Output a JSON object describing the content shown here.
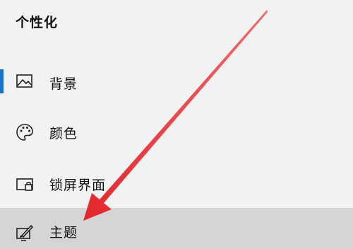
{
  "section": {
    "title": "个性化"
  },
  "nav": {
    "items": [
      {
        "label": "背景",
        "icon": "picture-icon",
        "selected": true
      },
      {
        "label": "颜色",
        "icon": "palette-icon",
        "selected": false
      },
      {
        "label": "锁屏界面",
        "icon": "lock-screen-icon",
        "selected": false
      },
      {
        "label": "主题",
        "icon": "theme-brush-icon",
        "selected": false,
        "hovered": true
      }
    ]
  },
  "colors": {
    "accent": "#1a73c9",
    "arrow": "#e8343a",
    "hover_background": "#d5d5d5",
    "page_background": "#f2f2f2"
  },
  "annotation": {
    "type": "arrow",
    "points_to": "主题"
  }
}
